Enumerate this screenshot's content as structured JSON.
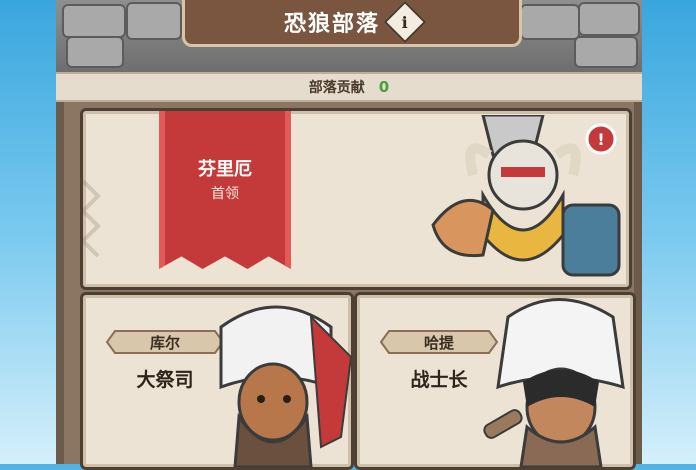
{
  "header": {
    "title": "恐狼部落",
    "info_icon": "info-icon"
  },
  "contribution": {
    "label": "部落贡献",
    "value": "0"
  },
  "leader": {
    "name": "芬里厄",
    "role": "首领",
    "alert_icon": "exclamation-icon"
  },
  "members": [
    {
      "name": "库尔",
      "role": "大祭司"
    },
    {
      "name": "哈提",
      "role": "战士长"
    }
  ],
  "colors": {
    "banner": "#c43a3a",
    "panel": "#6c5a4a",
    "card": "#ece3d4",
    "contribution_value": "#4aa13a"
  }
}
